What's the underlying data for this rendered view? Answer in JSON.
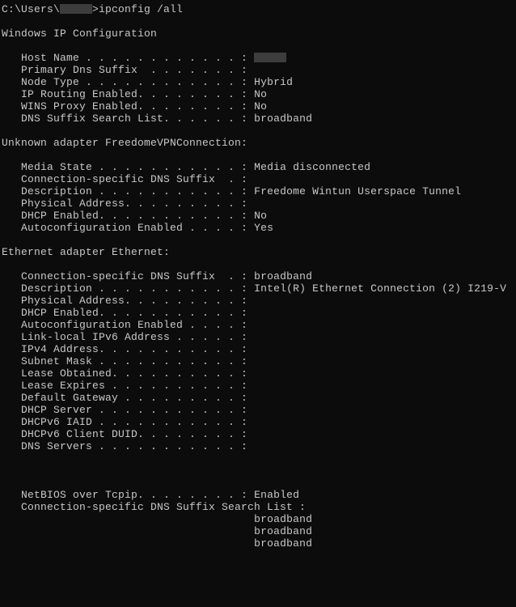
{
  "prompt": {
    "prefix": "C:\\Users\\",
    "user": "",
    "command": ">ipconfig /all"
  },
  "sections": {
    "global_header": "Windows IP Configuration",
    "global": {
      "host_name_label": "   Host Name . . . . . . . . . . . . : ",
      "host_name_value": "",
      "primary_dns_label": "   Primary Dns Suffix  . . . . . . . :",
      "node_type_label": "   Node Type . . . . . . . . . . . . : ",
      "node_type_value": "Hybrid",
      "ip_routing_label": "   IP Routing Enabled. . . . . . . . : ",
      "ip_routing_value": "No",
      "wins_proxy_label": "   WINS Proxy Enabled. . . . . . . . : ",
      "wins_proxy_value": "No",
      "dns_suffix_list_label": "   DNS Suffix Search List. . . . . . : ",
      "dns_suffix_list_value": "broadband"
    },
    "adapter1_header": "Unknown adapter FreedomeVPNConnection:",
    "adapter1": {
      "media_state_label": "   Media State . . . . . . . . . . . : ",
      "media_state_value": "Media disconnected",
      "conn_dns_label": "   Connection-specific DNS Suffix  . :",
      "description_label": "   Description . . . . . . . . . . . : ",
      "description_value": "Freedome Wintun Userspace Tunnel",
      "phys_addr_label": "   Physical Address. . . . . . . . . :",
      "dhcp_enabled_label": "   DHCP Enabled. . . . . . . . . . . : ",
      "dhcp_enabled_value": "No",
      "autoconf_label": "   Autoconfiguration Enabled . . . . : ",
      "autoconf_value": "Yes"
    },
    "adapter2_header": "Ethernet adapter Ethernet:",
    "adapter2": {
      "conn_dns_label": "   Connection-specific DNS Suffix  . : ",
      "conn_dns_value": "broadband",
      "description_label": "   Description . . . . . . . . . . . : ",
      "description_value": "Intel(R) Ethernet Connection (2) I219-V",
      "phys_addr_label": "   Physical Address. . . . . . . . . :",
      "dhcp_enabled_label": "   DHCP Enabled. . . . . . . . . . . :",
      "autoconf_label": "   Autoconfiguration Enabled . . . . :",
      "link_local_label": "   Link-local IPv6 Address . . . . . :",
      "ipv4_label": "   IPv4 Address. . . . . . . . . . . :",
      "subnet_label": "   Subnet Mask . . . . . . . . . . . :",
      "lease_obtained_label": "   Lease Obtained. . . . . . . . . . :",
      "lease_expires_label": "   Lease Expires . . . . . . . . . . :",
      "default_gw_label": "   Default Gateway . . . . . . . . . :",
      "dhcp_server_label": "   DHCP Server . . . . . . . . . . . :",
      "dhcpv6_iaid_label": "   DHCPv6 IAID . . . . . . . . . . . :",
      "dhcpv6_duid_label": "   DHCPv6 Client DUID. . . . . . . . :",
      "dns_servers_label": "   DNS Servers . . . . . . . . . . . :",
      "blank1": "",
      "blank2": "",
      "blank3": "",
      "netbios_label": "   NetBIOS over Tcpip. . . . . . . . : ",
      "netbios_value": "Enabled",
      "suffix_list_header": "   Connection-specific DNS Suffix Search List :",
      "suffix_indent": "                                       ",
      "suffix1": "broadband",
      "suffix2": "broadband",
      "suffix3": "broadband"
    }
  }
}
